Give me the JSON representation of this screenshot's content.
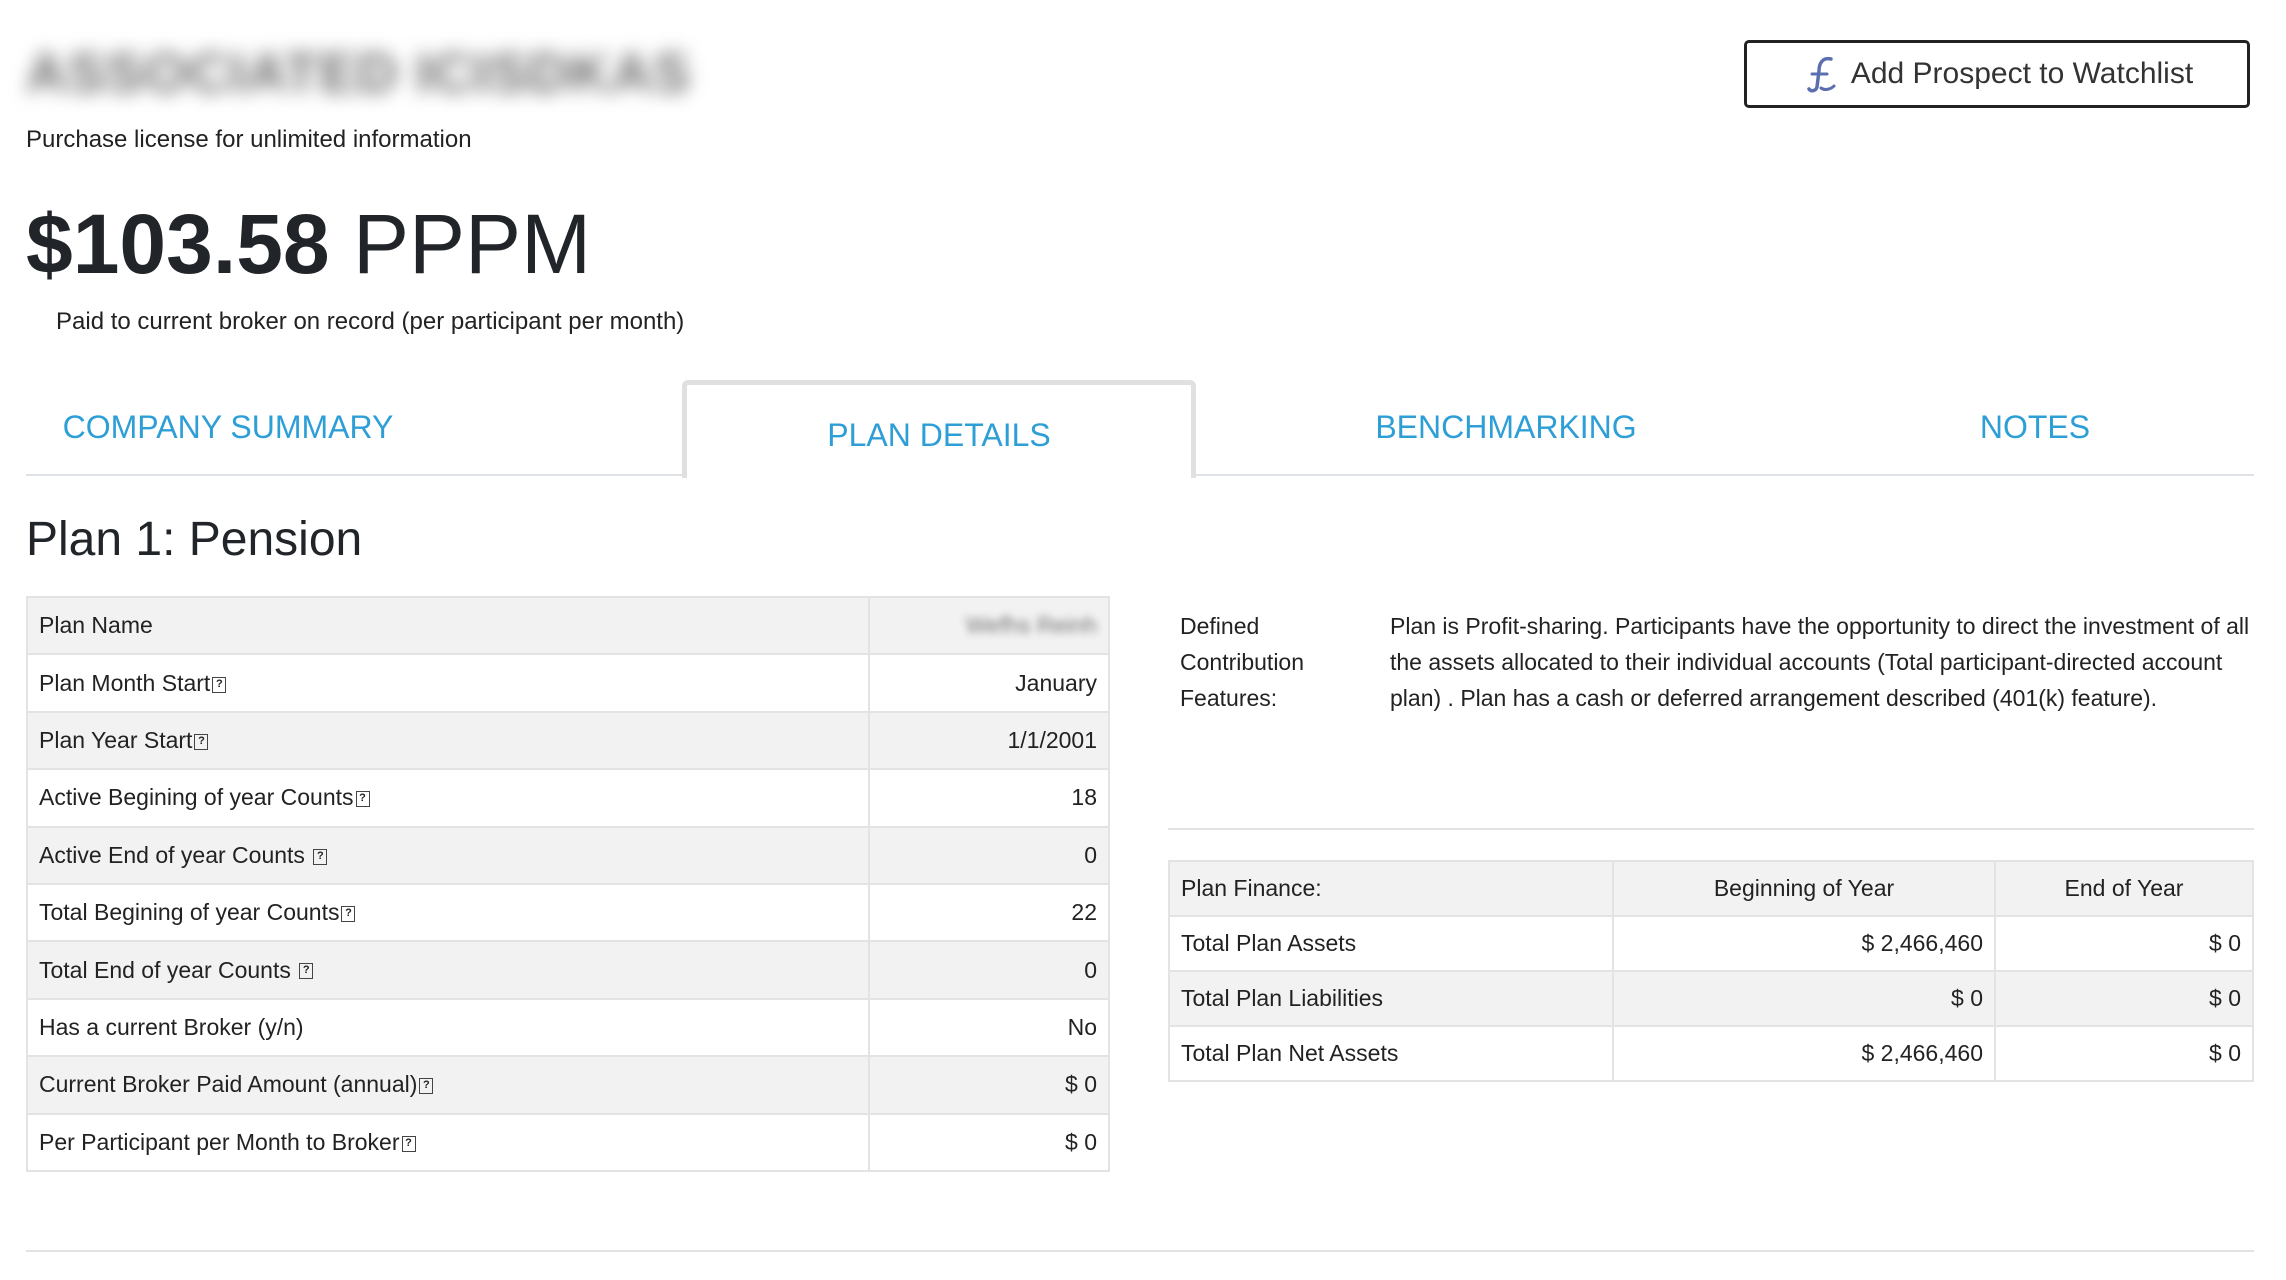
{
  "header": {
    "company_name": "ASSOCIATED ICISDKAS",
    "purchase_note": "Purchase license for unlimited information",
    "watchlist_button": "Add Prospect to Watchlist"
  },
  "pppm": {
    "amount": "$103.58",
    "unit": "PPPM",
    "note": "Paid to current broker on record (per participant per month)"
  },
  "tabs": [
    {
      "label": "COMPANY SUMMARY"
    },
    {
      "label": "PLAN DETAILS"
    },
    {
      "label": "BENCHMARKING"
    },
    {
      "label": "NOTES"
    }
  ],
  "plan": {
    "title": "Plan 1: Pension",
    "rows": [
      {
        "label": "Plan Name",
        "value": "Wefhs Reinh",
        "help": false
      },
      {
        "label": "Plan Month Start",
        "value": "January",
        "help": true
      },
      {
        "label": "Plan Year Start",
        "value": "1/1/2001",
        "help": true
      },
      {
        "label": "Active Begining of year Counts",
        "value": "18",
        "help": true
      },
      {
        "label": "Active End of year Counts ",
        "value": "0",
        "help": true
      },
      {
        "label": "Total Begining of year Counts",
        "value": "22",
        "help": true
      },
      {
        "label": "Total End of year Counts ",
        "value": "0",
        "help": true
      },
      {
        "label": "Has a current Broker (y/n)",
        "value": "No",
        "help": false
      },
      {
        "label": "Current Broker Paid Amount (annual)",
        "value": "$ 0",
        "help": true
      },
      {
        "label": "Per Participant per Month to Broker",
        "value": "$ 0",
        "help": true
      }
    ]
  },
  "dc_features": {
    "label": "Defined Contribution Features:",
    "text": "Plan is Profit-sharing. Participants have the opportunity to direct the investment of all the assets allocated to their individual accounts (Total participant-directed account plan) . Plan has a cash or deferred arrangement described (401(k) feature)."
  },
  "finance": {
    "headers": [
      "Plan Finance:",
      "Beginning of Year",
      "End of Year"
    ],
    "rows": [
      {
        "label": "Total Plan Assets",
        "begin": "$ 2,466,460",
        "end": "$ 0"
      },
      {
        "label": "Total Plan Liabilities",
        "begin": "$ 0",
        "end": "$ 0"
      },
      {
        "label": "Total Plan Net Assets",
        "begin": "$ 2,466,460",
        "end": "$ 0"
      }
    ]
  },
  "help_glyph": "?",
  "colors": {
    "tab_text": "#2e9fd6",
    "watchlist_icon": "#5b6fb0"
  }
}
